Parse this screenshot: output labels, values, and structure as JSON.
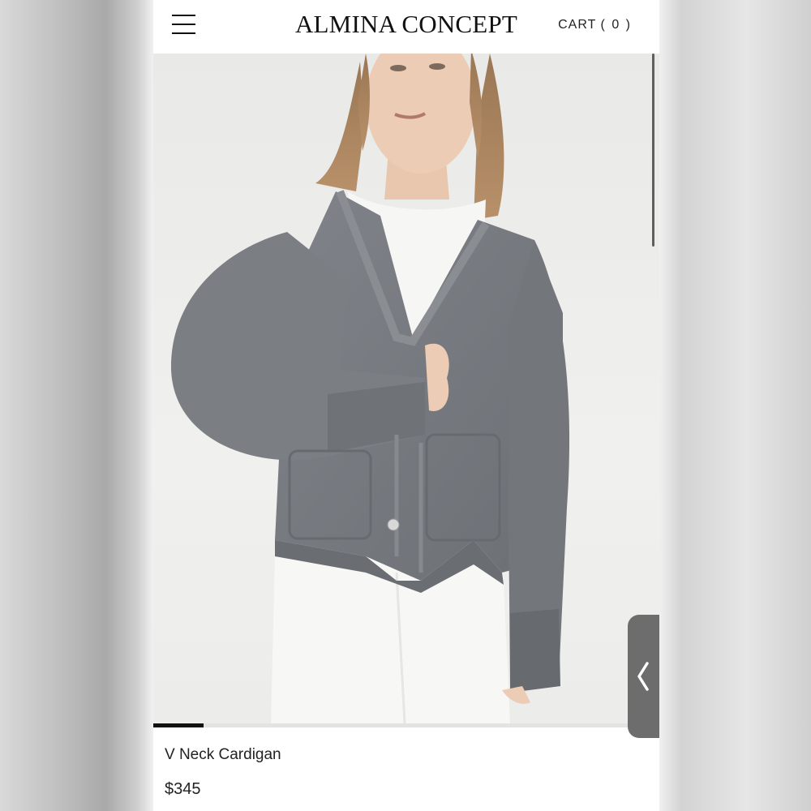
{
  "header": {
    "menu_icon": "hamburger-menu-icon",
    "brand": "ALMINA CONCEPT",
    "cart_label": "CART",
    "cart_count": "( 0 )"
  },
  "hero": {
    "image": "model-wearing-grey-v-neck-cardigan",
    "gallery_progress": 0.1
  },
  "side_tab": {
    "icon": "chevron-left-icon"
  },
  "product": {
    "name": "V Neck Cardigan",
    "price": "$345"
  },
  "colors": {
    "cardigan": "#777b7f",
    "background": "#ffffff",
    "text": "#222222"
  }
}
